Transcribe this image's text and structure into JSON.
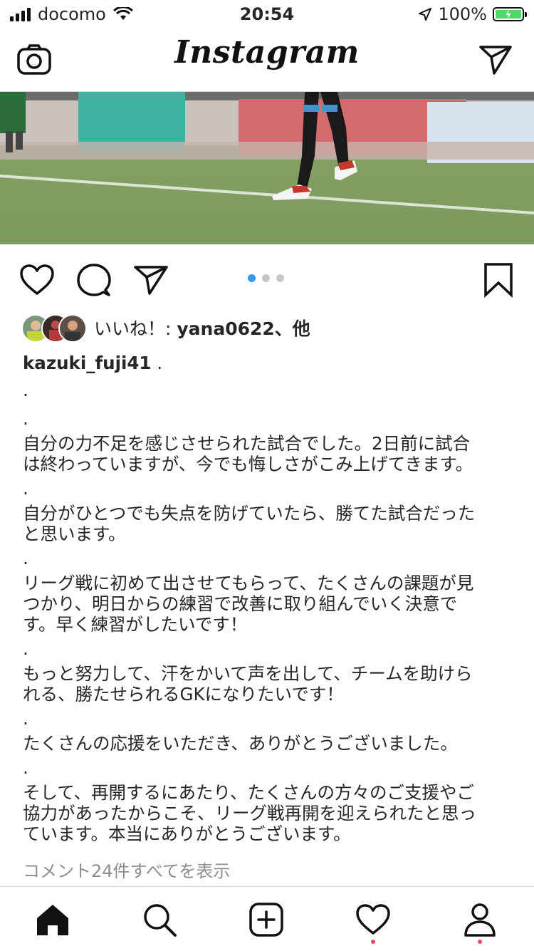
{
  "status_bar": {
    "carrier": "docomo",
    "time": "20:54",
    "battery_percent": "100%"
  },
  "header": {
    "logo": "Instagram",
    "camera_icon": "camera-icon",
    "direct_icon": "paper-plane-icon"
  },
  "post": {
    "image_description_icon": "soccer-player-photo",
    "carousel": {
      "total": 3,
      "active_index": 0
    },
    "likes": {
      "prefix": "いいね！: ",
      "user": "yana0622",
      "suffix": "、他"
    },
    "caption": {
      "username": "kazuki_fuji41",
      "first": " .",
      "lines": [
        ".",
        ".",
        "自分の力不足を感じさせられた試合でした。2日前に試合",
        "は終わっていますが、今でも悔しさがこみ上げてきます。",
        ".",
        "自分がひとつでも失点を防げていたら、勝てた試合だった",
        "と思います。",
        ".",
        "リーグ戦に初めて出させてもらって、たくさんの課題が見",
        "つかり、明日からの練習で改善に取り組んでいく決意で",
        "す。早く練習がしたいです！",
        ".",
        "もっと努力して、汗をかいて声を出して、チームを助けら",
        "れる、勝たせられるGKになりたいです！",
        ".",
        "たくさんの応援をいただき、ありがとうございました。",
        ".",
        "そして、再開するにあたり、たくさんの方々のご支援やご",
        "協力があったからこそ、リーグ戦再開を迎えられたと思っ",
        "ています。本当にありがとうございます。"
      ]
    },
    "view_comments": "コメント24件すべてを表示"
  },
  "tab_bar": {
    "items": [
      "home-icon",
      "search-icon",
      "add-post-icon",
      "activity-heart-icon",
      "profile-icon"
    ]
  },
  "colors": {
    "accent": "#3897f0",
    "notification": "#ed4956",
    "battery": "#4cd964"
  }
}
